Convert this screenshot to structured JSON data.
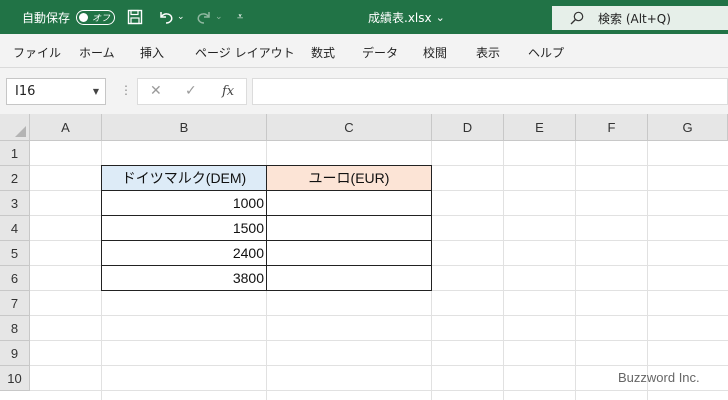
{
  "titlebar": {
    "autosave_label": "自動保存",
    "autosave_state": "オフ",
    "filename": "成績表.xlsx",
    "search_label": "検索 (Alt+Q)"
  },
  "ribbon": {
    "tabs": [
      "ファイル",
      "ホーム",
      "挿入",
      "ページ レイアウト",
      "数式",
      "データ",
      "校閲",
      "表示",
      "ヘルプ"
    ]
  },
  "formula_bar": {
    "name_box": "I16",
    "fx_label": "fx",
    "formula": ""
  },
  "sheet": {
    "columns": [
      "A",
      "B",
      "C",
      "D",
      "E",
      "F",
      "G"
    ],
    "rows": [
      "1",
      "2",
      "3",
      "4",
      "5",
      "6",
      "7",
      "8",
      "9",
      "10"
    ],
    "table": {
      "header_b": "ドイツマルク(DEM)",
      "header_c": "ユーロ(EUR)",
      "values_b": [
        "1000",
        "1500",
        "2400",
        "3800"
      ],
      "values_c": [
        "",
        "",
        "",
        ""
      ]
    },
    "colors": {
      "header_b_fill": "#ddebf7",
      "header_c_fill": "#fce4d6",
      "accent": "#217346"
    }
  },
  "watermark": "Buzzword Inc."
}
